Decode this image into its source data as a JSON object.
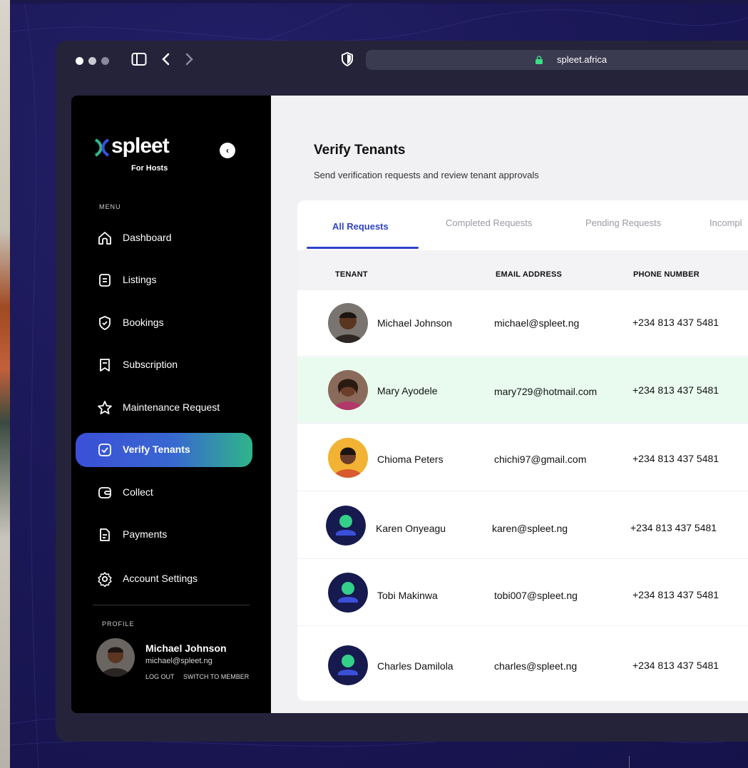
{
  "browser": {
    "url": "spleet.africa",
    "nav_back_icon": "chevron-left-icon",
    "nav_forward_icon": "chevron-right-icon"
  },
  "sidebar": {
    "brand": "spleet",
    "brand_sub": "For Hosts",
    "menu_label": "MENU",
    "items": [
      {
        "label": "Dashboard",
        "icon": "home-icon"
      },
      {
        "label": "Listings",
        "icon": "document-icon"
      },
      {
        "label": "Bookings",
        "icon": "shield-check-icon"
      },
      {
        "label": "Subscription",
        "icon": "receipt-icon"
      },
      {
        "label": "Maintenance Request",
        "icon": "star-icon"
      },
      {
        "label": "Verify Tenants",
        "icon": "checkbox-icon",
        "active": true
      },
      {
        "label": "Collect",
        "icon": "wallet-icon"
      },
      {
        "label": "Payments",
        "icon": "file-icon"
      },
      {
        "label": "Account Settings",
        "icon": "gear-icon"
      }
    ],
    "profile_label": "PROFILE",
    "profile": {
      "name": "Michael Johnson",
      "email": "michael@spleet.ng",
      "logout": "LOG OUT",
      "switch": "SWITCH TO MEMBER"
    }
  },
  "main": {
    "title": "Verify Tenants",
    "subtitle": "Send verification requests and review tenant approvals",
    "tabs": [
      {
        "label": "All Requests",
        "active": true
      },
      {
        "label": "Completed Requests"
      },
      {
        "label": "Pending Requests"
      },
      {
        "label": "Incompl"
      }
    ],
    "columns": [
      "TENANT",
      "EMAIL ADDRESS",
      "PHONE NUMBER"
    ],
    "rows": [
      {
        "name": "Michael Johnson",
        "email": "michael@spleet.ng",
        "phone": "+234 813 437 5481",
        "avatar": "photo"
      },
      {
        "name": "Mary Ayodele",
        "email": "mary729@hotmail.com",
        "phone": "+234 813 437 5481",
        "avatar": "photo"
      },
      {
        "name": "Chioma Peters",
        "email": "chichi97@gmail.com",
        "phone": "+234 813 437 5481",
        "avatar": "photo"
      },
      {
        "name": "Karen Onyeagu",
        "email": "karen@spleet.ng",
        "phone": "+234 813 437 5481",
        "avatar": "placeholder"
      },
      {
        "name": "Tobi Makinwa",
        "email": "tobi007@spleet.ng",
        "phone": "+234 813 437 5481",
        "avatar": "placeholder"
      },
      {
        "name": "Charles Damilola",
        "email": "charles@spleet.ng",
        "phone": "+234 813 437 5481",
        "avatar": "placeholder"
      }
    ]
  },
  "colors": {
    "accent": "#2f44c8",
    "highlight_row": "#e9fbef",
    "sidebar_bg": "#000000",
    "active_gradient_end": "#2fb58a"
  }
}
